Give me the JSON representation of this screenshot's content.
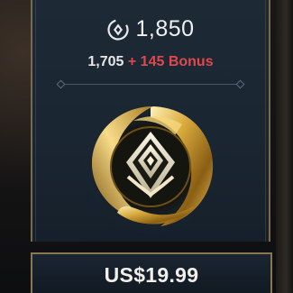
{
  "bundle": {
    "currency_icon": "riot-points-icon",
    "total_amount": "1,850",
    "base_amount": "1,705",
    "bonus_text": "+ 145 Bonus",
    "emblem_icon": "riot-points-emblem-icon",
    "price": "US$19.99"
  },
  "colors": {
    "bonus": "#e0484c",
    "gold_border": "#8a7750",
    "panel": "#1c2935"
  }
}
